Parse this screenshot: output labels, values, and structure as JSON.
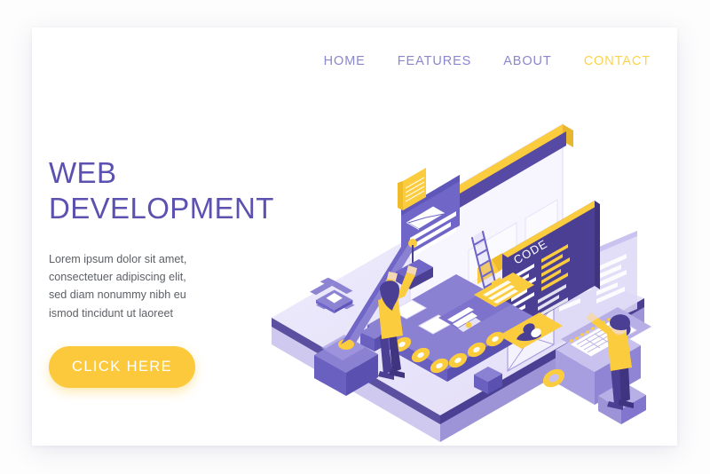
{
  "page": {
    "background_color": "#fdfdfd",
    "card_background": "#ffffff"
  },
  "palette": {
    "brand_purple": "#5b51b0",
    "nav_purple": "#8b87cf",
    "accent_yellow": "#fcc93c",
    "nav_accent_yellow": "#fcd34a",
    "body_text": "#5d6066",
    "deep_purple": "#4b3f94",
    "mid_purple": "#6c63c7",
    "light_lavender": "#e9e6fa",
    "pale_lavender": "#d7d2f5",
    "white": "#ffffff"
  },
  "nav": {
    "items": [
      {
        "label": "HOME",
        "accent": false
      },
      {
        "label": "FEATURES",
        "accent": false
      },
      {
        "label": "ABOUT",
        "accent": false
      },
      {
        "label": "CONTACT",
        "accent": true
      }
    ]
  },
  "hero": {
    "headline": "WEB\nDEVELOPMENT",
    "subcopy": "Lorem ipsum dolor sit amet,\nconsectetuer adipiscing elit,\nsed diam nonummy nibh eu\nismod tincidunt ut laoreet",
    "cta_label": "CLICK HERE"
  },
  "illustration": {
    "description": "Isometric web-development factory scene on a lavender platform",
    "code_panel_label": "CODE",
    "elements": [
      {
        "name": "browser-window",
        "detail": "isometric browser with yellow title bar and three purple dots"
      },
      {
        "name": "email-card",
        "detail": "panel with envelope icon and text lines"
      },
      {
        "name": "image-card",
        "detail": "panel with mountain/photo placeholder glyph"
      },
      {
        "name": "code-panel",
        "detail": "dark purple panel labelled CODE with yellow and white code lines"
      },
      {
        "name": "conveyor-belt",
        "detail": "purple belt with yellow rollers carrying UI cards"
      },
      {
        "name": "avatar-card",
        "detail": "yellow card with user silhouette"
      },
      {
        "name": "crane",
        "detail": "purple crane arm lifting a UI block"
      },
      {
        "name": "worker-left",
        "detail": "person in yellow top placing a UI element"
      },
      {
        "name": "worker-right",
        "detail": "person in yellow top operating the printing press"
      },
      {
        "name": "printing-press",
        "detail": "machine outputting a wireframe sheet"
      },
      {
        "name": "ladder",
        "detail": "purple isometric ladder"
      },
      {
        "name": "wireframe-frames",
        "detail": "outlined placeholder boxes with diagonal crosses"
      },
      {
        "name": "gear-icon-large",
        "detail": "floating flat gear"
      },
      {
        "name": "gear-icon-small",
        "detail": "floating flat gear near data panel"
      },
      {
        "name": "data-panel",
        "detail": "translucent panel with rows of text lines"
      },
      {
        "name": "crates",
        "detail": "small purple cubes on the platform"
      }
    ]
  }
}
